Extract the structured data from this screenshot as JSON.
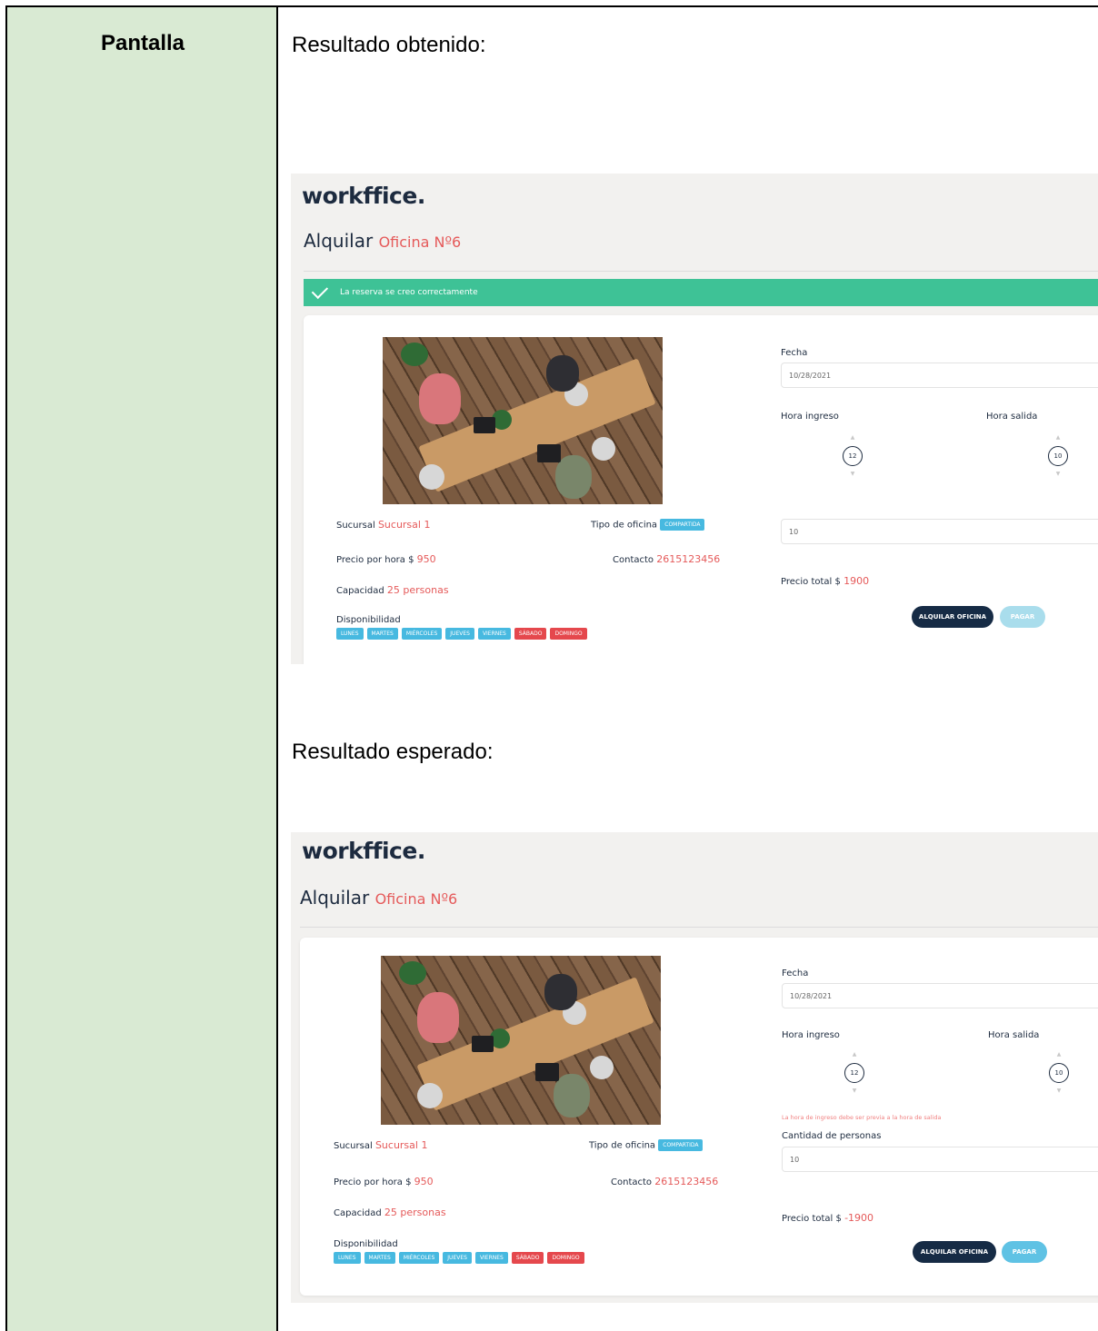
{
  "left_header": "Pantalla",
  "captions": {
    "obtained": "Resultado obtenido:",
    "expected": "Resultado esperado:"
  },
  "app": {
    "logo": "workffice.",
    "heading_prefix": "Alquilar",
    "heading_accent": "Oficina Nº6",
    "success_alert": "La reserva se creo correctamente",
    "sucursal_label": "Sucursal",
    "sucursal_value": "Sucursal 1",
    "tipo_label": "Tipo de oficina",
    "tipo_value": "COMPARTIDA",
    "precio_label": "Precio por hora $",
    "precio_value": "950",
    "contacto_label": "Contacto",
    "contacto_value": "2615123456",
    "capacidad_label": "Capacidad",
    "capacidad_value": "25 personas",
    "disponibilidad_label": "Disponibilidad",
    "days": [
      {
        "label": "LUNES",
        "color": "#47b9e0"
      },
      {
        "label": "MARTES",
        "color": "#47b9e0"
      },
      {
        "label": "MIÉRCOLES",
        "color": "#47b9e0"
      },
      {
        "label": "JUEVES",
        "color": "#47b9e0"
      },
      {
        "label": "VIERNES",
        "color": "#47b9e0"
      },
      {
        "label": "SÁBADO",
        "color": "#e5484d"
      },
      {
        "label": "DOMINGO",
        "color": "#e5484d"
      }
    ],
    "fecha_label": "Fecha",
    "fecha_value": "10/28/2021",
    "hora_ingreso_label": "Hora ingreso",
    "hora_salida_label": "Hora salida",
    "hora_ingreso_value": "12",
    "hora_salida_value": "10",
    "cantidad_label": "Cantidad de personas",
    "cantidad_value": "10",
    "precio_total_label": "Precio total $",
    "precio_total_obtained": "1900",
    "precio_total_expected": "-1900",
    "error_message": "La hora de ingreso debe ser previa a la hora de salida",
    "alquilar_button": "ALQUILAR OFICINA",
    "pagar_button": "PAGAR"
  }
}
